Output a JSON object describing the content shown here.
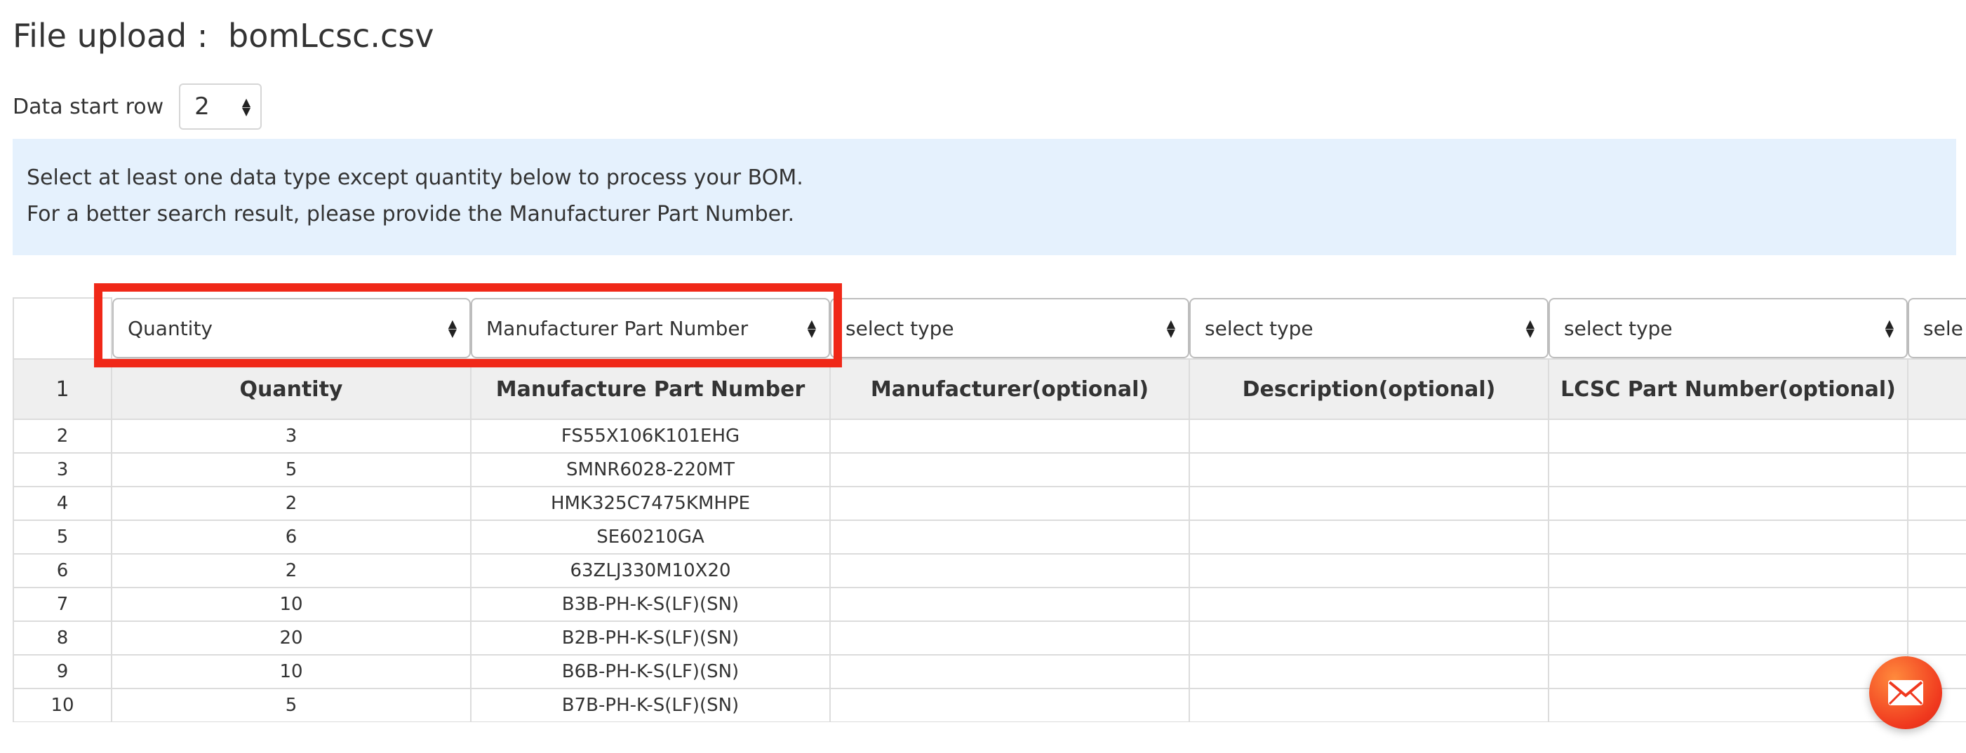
{
  "header": {
    "title_label": "File upload :",
    "filename": "bomLcsc.csv"
  },
  "start_row": {
    "label": "Data start row",
    "value": "2"
  },
  "notice": {
    "line1": "Select at least one data type except quantity below to process your BOM.",
    "line2": "For a better search result, please provide the Manufacturer Part Number."
  },
  "type_selects": [
    "Quantity",
    "Manufacturer Part Number",
    "select type",
    "select type",
    "select type",
    "sele"
  ],
  "header_row": {
    "row_number": "1",
    "cells": [
      "Quantity",
      "Manufacture Part Number",
      "Manufacturer(optional)",
      "Description(optional)",
      "LCSC Part Number(optional)",
      ""
    ]
  },
  "rows": [
    {
      "n": "2",
      "qty": "3",
      "mpn": "FS55X106K101EHG"
    },
    {
      "n": "3",
      "qty": "5",
      "mpn": "SMNR6028-220MT"
    },
    {
      "n": "4",
      "qty": "2",
      "mpn": "HMK325C7475KMHPE"
    },
    {
      "n": "5",
      "qty": "6",
      "mpn": "SE60210GA"
    },
    {
      "n": "6",
      "qty": "2",
      "mpn": "63ZLJ330M10X20"
    },
    {
      "n": "7",
      "qty": "10",
      "mpn": "B3B-PH-K-S(LF)(SN)"
    },
    {
      "n": "8",
      "qty": "20",
      "mpn": "B2B-PH-K-S(LF)(SN)"
    },
    {
      "n": "9",
      "qty": "10",
      "mpn": "B6B-PH-K-S(LF)(SN)"
    },
    {
      "n": "10",
      "qty": "5",
      "mpn": "B7B-PH-K-S(LF)(SN)"
    }
  ],
  "icons": {
    "select_arrows": "sort-updown-icon",
    "contact": "mail-icon"
  },
  "colors": {
    "highlight": "#f02818",
    "notice_bg": "#e5f1fd",
    "header_bg": "#efefef",
    "fab": "#f0381e"
  }
}
